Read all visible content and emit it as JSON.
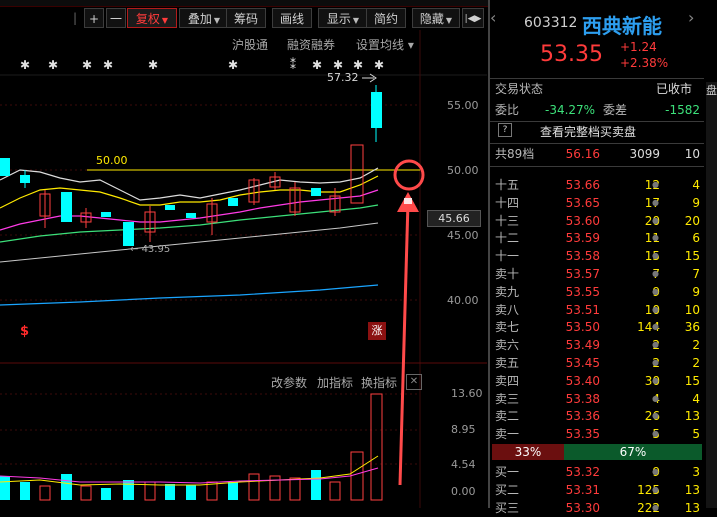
{
  "toolbar": {
    "buttons": [
      "|",
      "+",
      "一",
      "复权",
      "叠加",
      "筹码",
      "画线",
      "显示",
      "简约",
      "隐藏",
      "|◀▶"
    ]
  },
  "chart": {
    "top_links": [
      "沪股通",
      "融资融券",
      "设置均线"
    ],
    "price_labels": [
      "55.00",
      "50.00",
      "45.00",
      "40.00"
    ],
    "current_price": "45.66",
    "line_label": "50.00",
    "high_label": "57.32",
    "low_label": "43.95",
    "zhang_label": "涨",
    "s_mark": "$",
    "indicator_links": [
      "改参数",
      "加指标",
      "换指标"
    ],
    "vol_labels": [
      "13.60",
      "8.95",
      "4.54",
      "0.00"
    ]
  },
  "panel": {
    "code": "603312",
    "name": "西典新能",
    "price": "53.35",
    "change": "+1.24",
    "change_pct": "+2.38%",
    "status_label": "交易状态",
    "status_value": "已收市",
    "weibi_label": "委比",
    "weibi_value": "-34.27%",
    "weicha_label": "委差",
    "weicha_value": "-1582",
    "view_full": "查看完整档买卖盘",
    "total_levels": "共89档",
    "total_price": "56.16",
    "total_vol": "3099",
    "total_cnt": "10",
    "sell_rows": [
      {
        "label": "十五",
        "price": "53.66",
        "vol": "12",
        "cnt": "4"
      },
      {
        "label": "十四",
        "price": "53.65",
        "vol": "17",
        "cnt": "9"
      },
      {
        "label": "十三",
        "price": "53.60",
        "vol": "20",
        "cnt": "20"
      },
      {
        "label": "十二",
        "price": "53.59",
        "vol": "11",
        "cnt": "6"
      },
      {
        "label": "十一",
        "price": "53.58",
        "vol": "15",
        "cnt": "15"
      },
      {
        "label": "卖十",
        "price": "53.57",
        "vol": "7",
        "cnt": "7"
      },
      {
        "label": "卖九",
        "price": "53.55",
        "vol": "9",
        "cnt": "9"
      },
      {
        "label": "卖八",
        "price": "53.51",
        "vol": "10",
        "cnt": "10"
      },
      {
        "label": "卖七",
        "price": "53.50",
        "vol": "144",
        "cnt": "36"
      },
      {
        "label": "卖六",
        "price": "53.49",
        "vol": "2",
        "cnt": "2"
      },
      {
        "label": "卖五",
        "price": "53.45",
        "vol": "2",
        "cnt": "2"
      },
      {
        "label": "卖四",
        "price": "53.40",
        "vol": "30",
        "cnt": "15"
      },
      {
        "label": "卖三",
        "price": "53.38",
        "vol": "4",
        "cnt": "4"
      },
      {
        "label": "卖二",
        "price": "53.36",
        "vol": "26",
        "cnt": "13"
      },
      {
        "label": "卖一",
        "price": "53.35",
        "vol": "5",
        "cnt": "5"
      }
    ],
    "ratio_red": "33%",
    "ratio_green": "67%",
    "buy_rows": [
      {
        "label": "买一",
        "price": "53.32",
        "vol": "9",
        "cnt": "3"
      },
      {
        "label": "买二",
        "price": "53.31",
        "vol": "125",
        "cnt": "13"
      },
      {
        "label": "买三",
        "price": "53.30",
        "vol": "222",
        "cnt": "13"
      }
    ],
    "side_tab": "盘"
  },
  "colors": {
    "up": "#ff3b3b",
    "down": "#00ffff",
    "name": "#2d9eef"
  }
}
